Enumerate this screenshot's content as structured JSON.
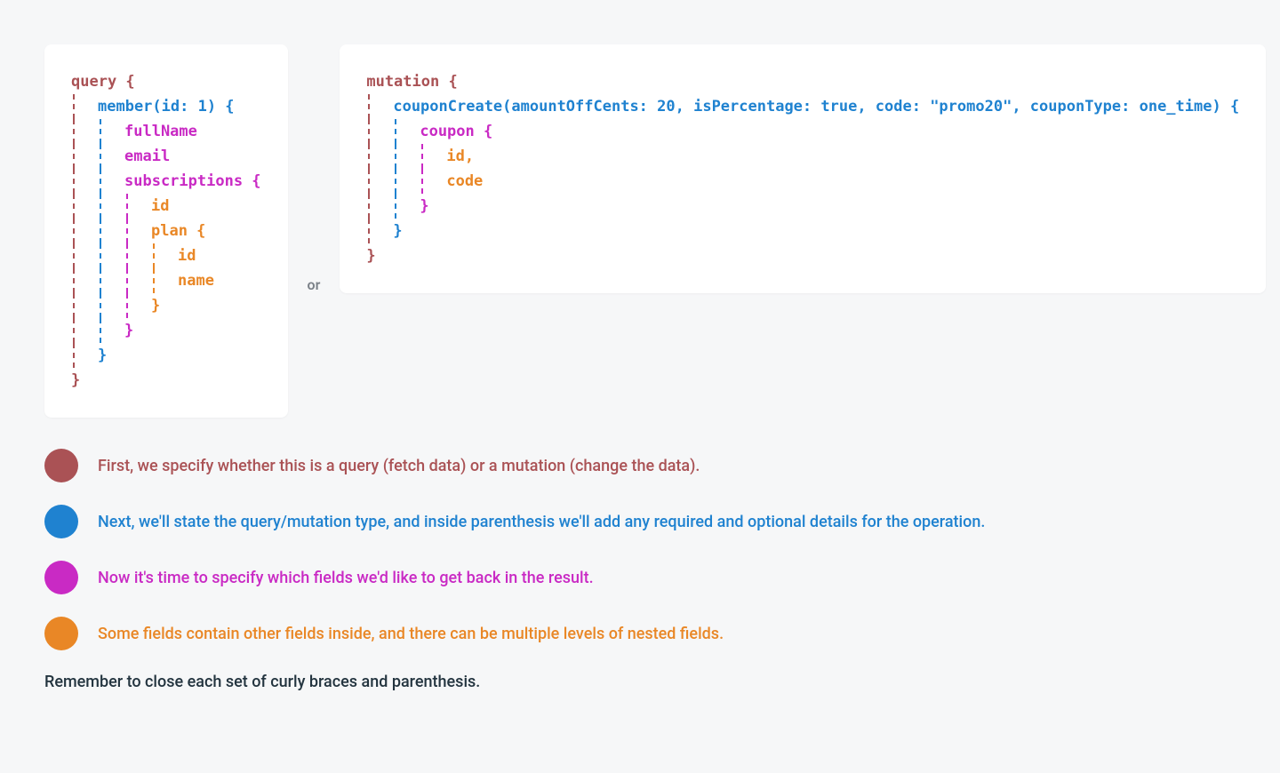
{
  "colors": {
    "red": "#aa5255",
    "blue": "#1f82d0",
    "pink": "#c92ac4",
    "orange": "#e98726"
  },
  "separator": "or",
  "code_left": {
    "lines": [
      {
        "guides": [],
        "text": "query {",
        "cls": "t-red"
      },
      {
        "guides": [
          "red"
        ],
        "text": "member(id: 1) {",
        "cls": "t-blue"
      },
      {
        "guides": [
          "red",
          "blue"
        ],
        "text": "fullName",
        "cls": "t-pink"
      },
      {
        "guides": [
          "red",
          "blue"
        ],
        "text": "email",
        "cls": "t-pink"
      },
      {
        "guides": [
          "red",
          "blue"
        ],
        "text": "subscriptions {",
        "cls": "t-pink"
      },
      {
        "guides": [
          "red",
          "blue",
          "pink"
        ],
        "text": "id",
        "cls": "t-orange"
      },
      {
        "guides": [
          "red",
          "blue",
          "pink"
        ],
        "text": "plan {",
        "cls": "t-orange"
      },
      {
        "guides": [
          "red",
          "blue",
          "pink",
          "orange"
        ],
        "text": "id",
        "cls": "t-orange"
      },
      {
        "guides": [
          "red",
          "blue",
          "pink",
          "orange"
        ],
        "text": "name",
        "cls": "t-orange"
      },
      {
        "guides": [
          "red",
          "blue",
          "pink"
        ],
        "text": "}",
        "cls": "t-orange"
      },
      {
        "guides": [
          "red",
          "blue"
        ],
        "text": "}",
        "cls": "t-pink"
      },
      {
        "guides": [
          "red"
        ],
        "text": "}",
        "cls": "t-blue"
      },
      {
        "guides": [],
        "text": "}",
        "cls": "t-red"
      }
    ]
  },
  "code_right": {
    "lines": [
      {
        "guides": [],
        "text": "mutation {",
        "cls": "t-red"
      },
      {
        "guides": [
          "red"
        ],
        "text": "couponCreate(amountOffCents: 20, isPercentage: true, code: \"promo20\", couponType: one_time) {",
        "cls": "t-blue"
      },
      {
        "guides": [
          "red",
          "blue"
        ],
        "text": "coupon {",
        "cls": "t-pink"
      },
      {
        "guides": [
          "red",
          "blue",
          "pink"
        ],
        "text": "id,",
        "cls": "t-orange"
      },
      {
        "guides": [
          "red",
          "blue",
          "pink"
        ],
        "text": "code",
        "cls": "t-orange"
      },
      {
        "guides": [
          "red",
          "blue"
        ],
        "text": "}",
        "cls": "t-pink"
      },
      {
        "guides": [
          "red"
        ],
        "text": "}",
        "cls": "t-blue"
      },
      {
        "guides": [],
        "text": "}",
        "cls": "t-red"
      }
    ]
  },
  "legend": [
    {
      "color": "red",
      "text": "First, we specify whether this is a query (fetch data) or a mutation (change the data)."
    },
    {
      "color": "blue",
      "text": "Next, we'll state the query/mutation type, and inside parenthesis we'll add any required and optional details for the operation."
    },
    {
      "color": "pink",
      "text": "Now it's time to specify which fields we'd like to get back in the result."
    },
    {
      "color": "orange",
      "text": "Some fields contain other fields inside, and there can be multiple levels of nested fields."
    }
  ],
  "note": "Remember to close each set of curly braces and parenthesis."
}
